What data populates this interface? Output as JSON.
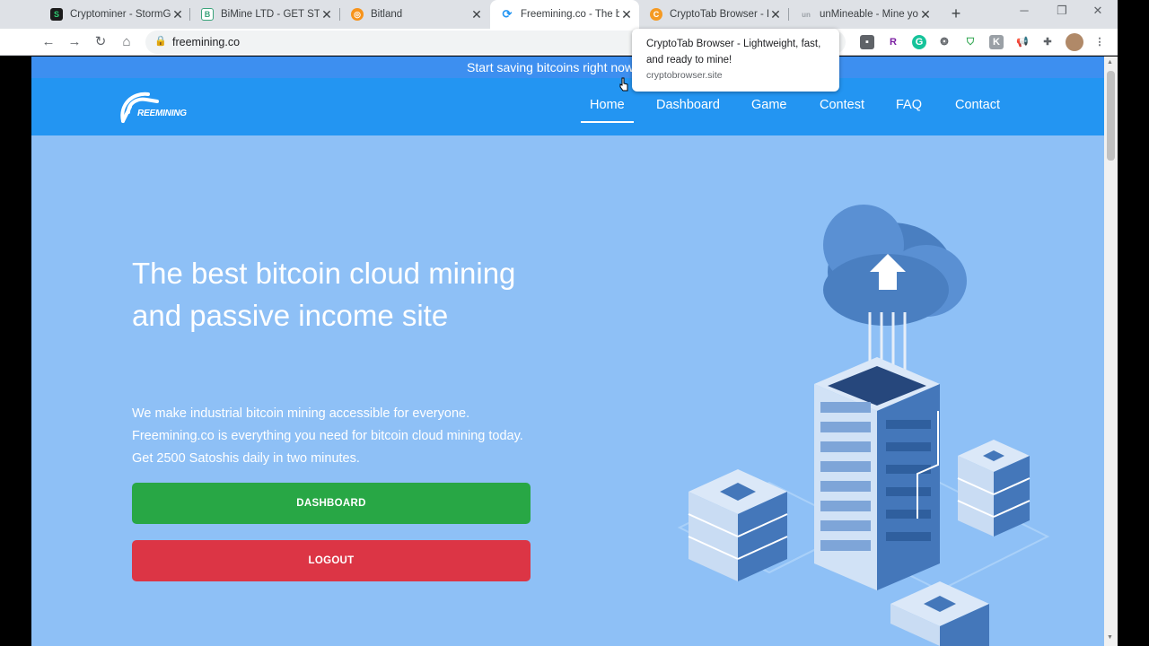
{
  "browser": {
    "tabs": [
      {
        "title": "Cryptominer - StormGain",
        "favicon": "stormgain-icon",
        "favicon_color": "#1b1b1b"
      },
      {
        "title": "BiMine LTD - GET STABLE",
        "favicon": "bimine-icon",
        "favicon_color": "#ffffff"
      },
      {
        "title": "Bitland",
        "favicon": "bitland-icon",
        "favicon_color": "#f7931a"
      },
      {
        "title": "Freemining.co - The best",
        "favicon": "freemining-icon",
        "favicon_color": "#2395f2"
      },
      {
        "title": "CryptoTab Browser - Light",
        "favicon": "cryptotab-icon",
        "favicon_color": "#f59a23"
      },
      {
        "title": "unMineable - Mine your",
        "favicon": "unmineable-icon",
        "favicon_color": "#dee1e6"
      }
    ],
    "active_tab": 3,
    "url": "freemining.co",
    "tooltip": {
      "title": "CryptoTab Browser - Lightweight, fast, and ready to mine!",
      "url": "cryptobrowser.site"
    }
  },
  "page": {
    "promo_text": "Start saving bitcoins right now for yo",
    "logo_text": "REEMINING",
    "nav": [
      {
        "label": "Home",
        "active": true
      },
      {
        "label": "Dashboard",
        "active": false
      },
      {
        "label": "Game",
        "active": false
      },
      {
        "label": "Contest",
        "active": false
      },
      {
        "label": "FAQ",
        "active": false
      },
      {
        "label": "Contact",
        "active": false
      }
    ],
    "headline": "The best bitcoin cloud mining and passive income site",
    "lead": "We make industrial bitcoin mining accessible for everyone. Freemining.co is everything you need for bitcoin cloud mining today. Get 2500 Satoshis daily in two minutes.",
    "dashboard_button": "DASHBOARD",
    "logout_button": "LOGOUT"
  },
  "colors": {
    "page_bg": "#8ec0f6",
    "navbar": "#2395f2",
    "promo": "#3d8ff0",
    "dashboard_button": "#28a745",
    "logout_button": "#dc3545"
  }
}
